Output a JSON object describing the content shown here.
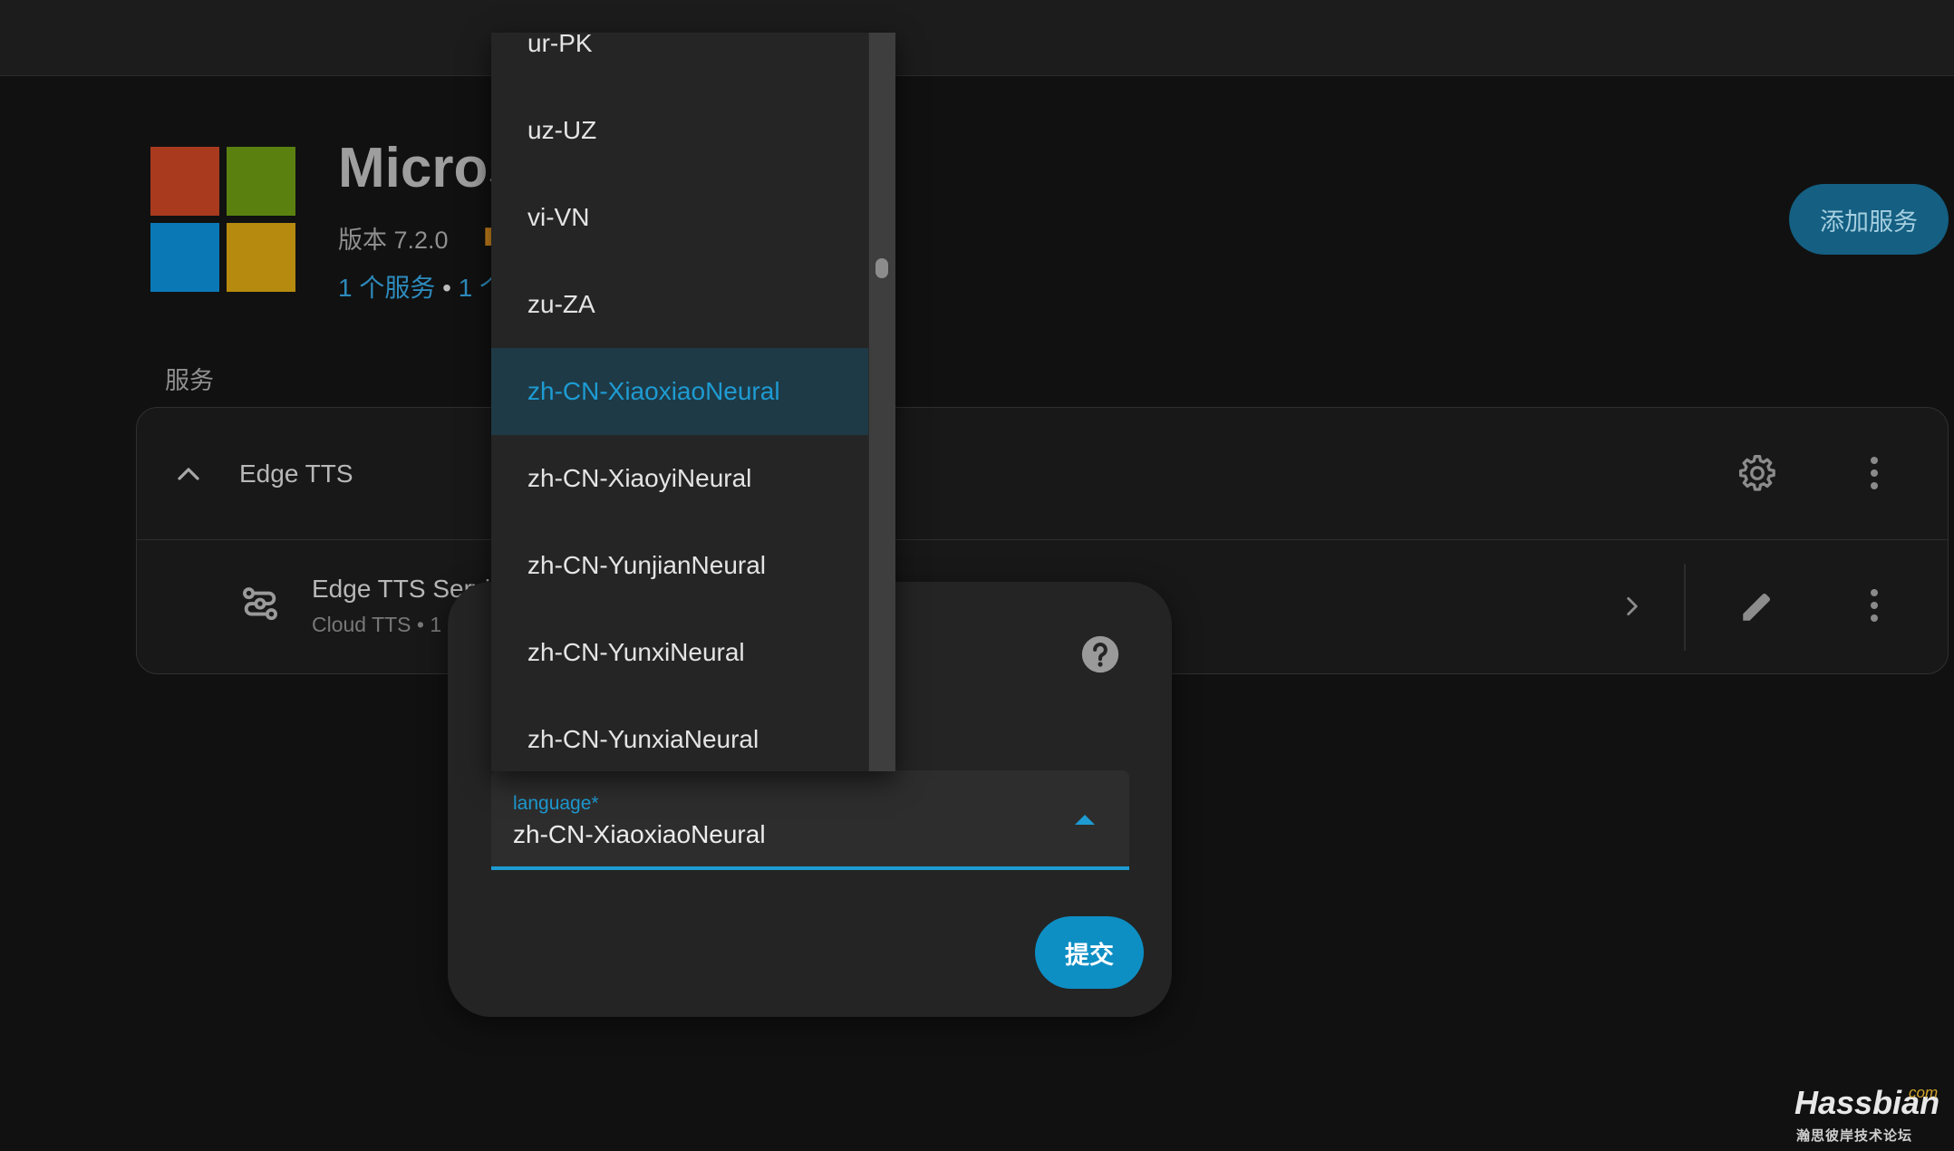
{
  "integration": {
    "title": "Micros",
    "version": "版本 7.2.0",
    "summary_services": "1 个服务",
    "summary_sep": " • ",
    "summary_entities": "1 个",
    "add_service_label": "添加服务",
    "logo_colors": [
      "#a93a1e",
      "#5a8110",
      "#0a78b5",
      "#b58a0f"
    ]
  },
  "services": {
    "section_label": "服务",
    "group_title": "Edge TTS",
    "entry": {
      "title": "Edge TTS Servi",
      "subtitle": "Cloud TTS • 1"
    }
  },
  "dialog": {
    "field_label": "language*",
    "field_value": "zh-CN-XiaoxiaoNeural",
    "submit_label": "提交"
  },
  "dropdown": {
    "items": [
      {
        "label": "ur-PK",
        "selected": false
      },
      {
        "label": "uz-UZ",
        "selected": false
      },
      {
        "label": "vi-VN",
        "selected": false
      },
      {
        "label": "zu-ZA",
        "selected": false
      },
      {
        "label": "zh-CN-XiaoxiaoNeural",
        "selected": true
      },
      {
        "label": "zh-CN-XiaoyiNeural",
        "selected": false
      },
      {
        "label": "zh-CN-YunjianNeural",
        "selected": false
      },
      {
        "label": "zh-CN-YunxiNeural",
        "selected": false
      },
      {
        "label": "zh-CN-YunxiaNeural",
        "selected": false
      }
    ]
  },
  "watermark": {
    "brand": "Hassbian",
    "tld": "com",
    "subtitle": "瀚思彼岸技术论坛"
  },
  "colors": {
    "accent": "#1e9bd2",
    "selected_bg": "#1e3a46",
    "background": "#111111"
  }
}
